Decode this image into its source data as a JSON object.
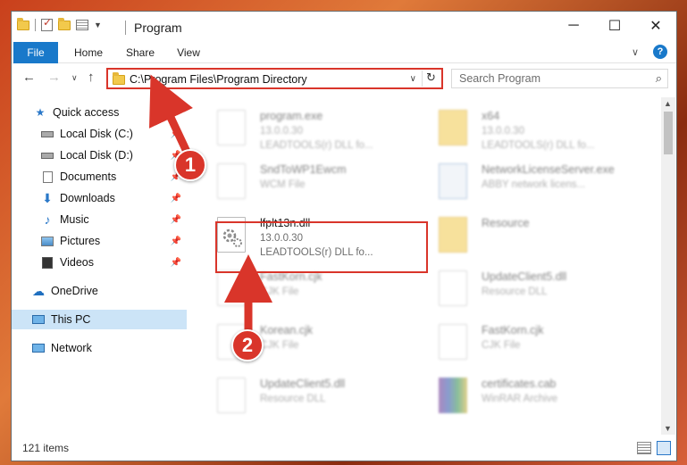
{
  "window": {
    "title": "Program",
    "controls": [
      "minimize-icon",
      "maximize-icon",
      "close-icon"
    ]
  },
  "ribbon": {
    "tabs": [
      {
        "label": "File"
      },
      {
        "label": "Home"
      },
      {
        "label": "Share"
      },
      {
        "label": "View"
      }
    ],
    "help_label": "?"
  },
  "address_bar": {
    "path": "C:\\Program Files\\Program Directory",
    "search_placeholder": "Search Program"
  },
  "sidebar": {
    "items": [
      {
        "label": "Quick access",
        "icon": "star-icon"
      },
      {
        "label": "Local Disk (C:)",
        "icon": "drive-icon"
      },
      {
        "label": "Local Disk (D:)",
        "icon": "drive-icon"
      },
      {
        "label": "Documents",
        "icon": "documents-icon"
      },
      {
        "label": "Downloads",
        "icon": "download-icon"
      },
      {
        "label": "Music",
        "icon": "music-icon"
      },
      {
        "label": "Pictures",
        "icon": "pictures-icon"
      },
      {
        "label": "Videos",
        "icon": "videos-icon"
      },
      {
        "label": "OneDrive",
        "icon": "cloud-icon"
      },
      {
        "label": "This PC",
        "icon": "computer-icon"
      },
      {
        "label": "Network",
        "icon": "network-icon"
      }
    ]
  },
  "files": [
    {
      "name": "program.exe",
      "line2": "13.0.0.30",
      "line3": "LEADTOOLS(r) DLL fo..."
    },
    {
      "name": "x64",
      "line2": "13.0.0.30",
      "line3": "LEADTOOLS(r) DLL fo..."
    },
    {
      "name": "SndToWP1Ewcm",
      "line2": "WCM File",
      "line3": ""
    },
    {
      "name": "NetworkLicenseServer.exe",
      "line2": "ABBY network licens...",
      "line3": ""
    },
    {
      "name": "lfplt13n.dll",
      "line2": "13.0.0.30",
      "line3": "LEADTOOLS(r) DLL fo..."
    },
    {
      "name": "Resource",
      "line2": "",
      "line3": ""
    },
    {
      "name": "FastKorn.cjk",
      "line2": "CJK File",
      "line3": ""
    },
    {
      "name": "UpdateClient5.dll",
      "line2": "Resource DLL",
      "line3": ""
    },
    {
      "name": "Korean.cjk",
      "line2": "CJK File",
      "line3": ""
    },
    {
      "name": "FastKorn.cjk",
      "line2": "CJK File",
      "line3": ""
    },
    {
      "name": "UpdateClient5.dll",
      "line2": "Resource DLL",
      "line3": ""
    },
    {
      "name": "certificates.cab",
      "line2": "WinRAR Archive",
      "line3": ""
    }
  ],
  "status": {
    "item_count": "121 items"
  },
  "annotations": {
    "step1": "1",
    "step2": "2",
    "color": "#d9352a"
  }
}
